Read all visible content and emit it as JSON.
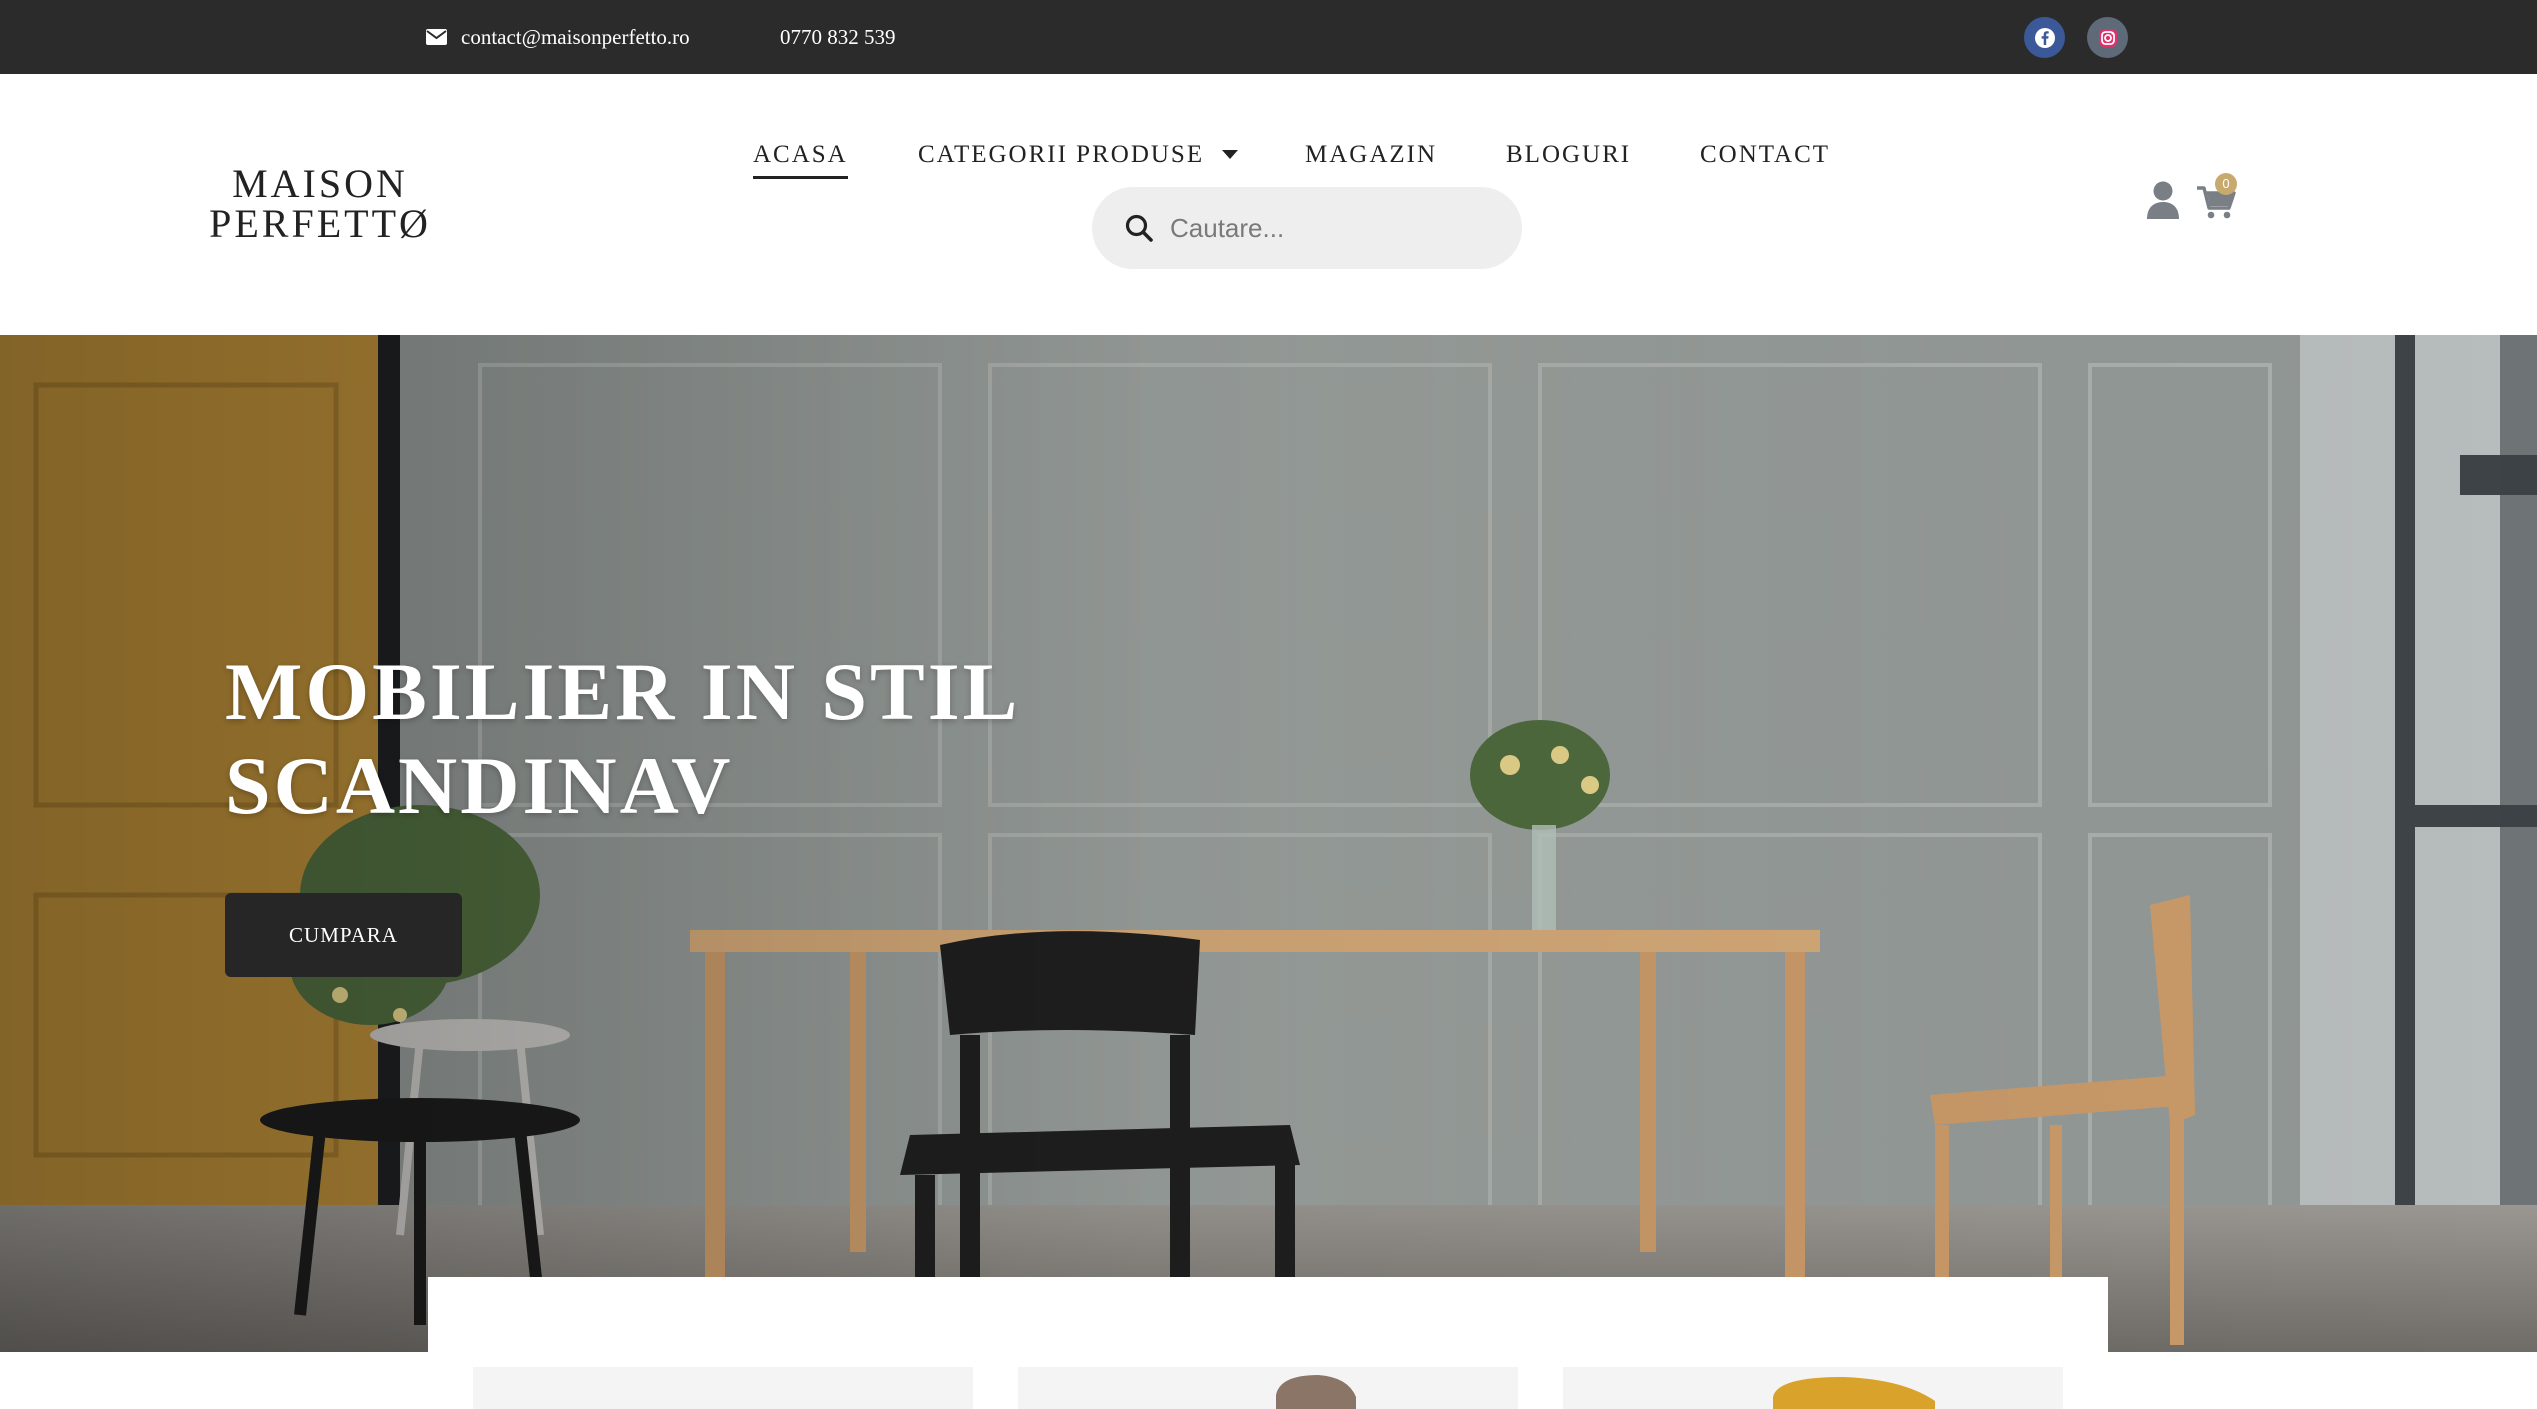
{
  "topbar": {
    "email": "contact@maisonperfetto.ro",
    "phone": "0770 832 539",
    "social": [
      {
        "name": "facebook",
        "icon": "facebook-icon",
        "color": "#3b5998"
      },
      {
        "name": "instagram",
        "icon": "instagram-icon",
        "color": "#5f6a78"
      }
    ]
  },
  "header": {
    "logo_line1": "MAISON",
    "logo_line2": "PERFETTØ",
    "nav": {
      "home": "ACASA",
      "categories": "CATEGORII PRODUSE",
      "shop": "MAGAZIN",
      "blogs": "BLOGURI",
      "contact": "CONTACT"
    },
    "active_nav": "ACASA",
    "search": {
      "placeholder": "Cautare...",
      "value": ""
    },
    "cart_count": "0"
  },
  "hero": {
    "title_line1": "MOBILIER IN STIL",
    "title_line2": "SCANDINAV",
    "cta_label": "CUMPARA"
  },
  "colors": {
    "topbar_bg": "#2b2b2b",
    "accent_badge": "#c8a96e",
    "cta_bg": "#262626",
    "search_bg": "#eeeeee"
  }
}
